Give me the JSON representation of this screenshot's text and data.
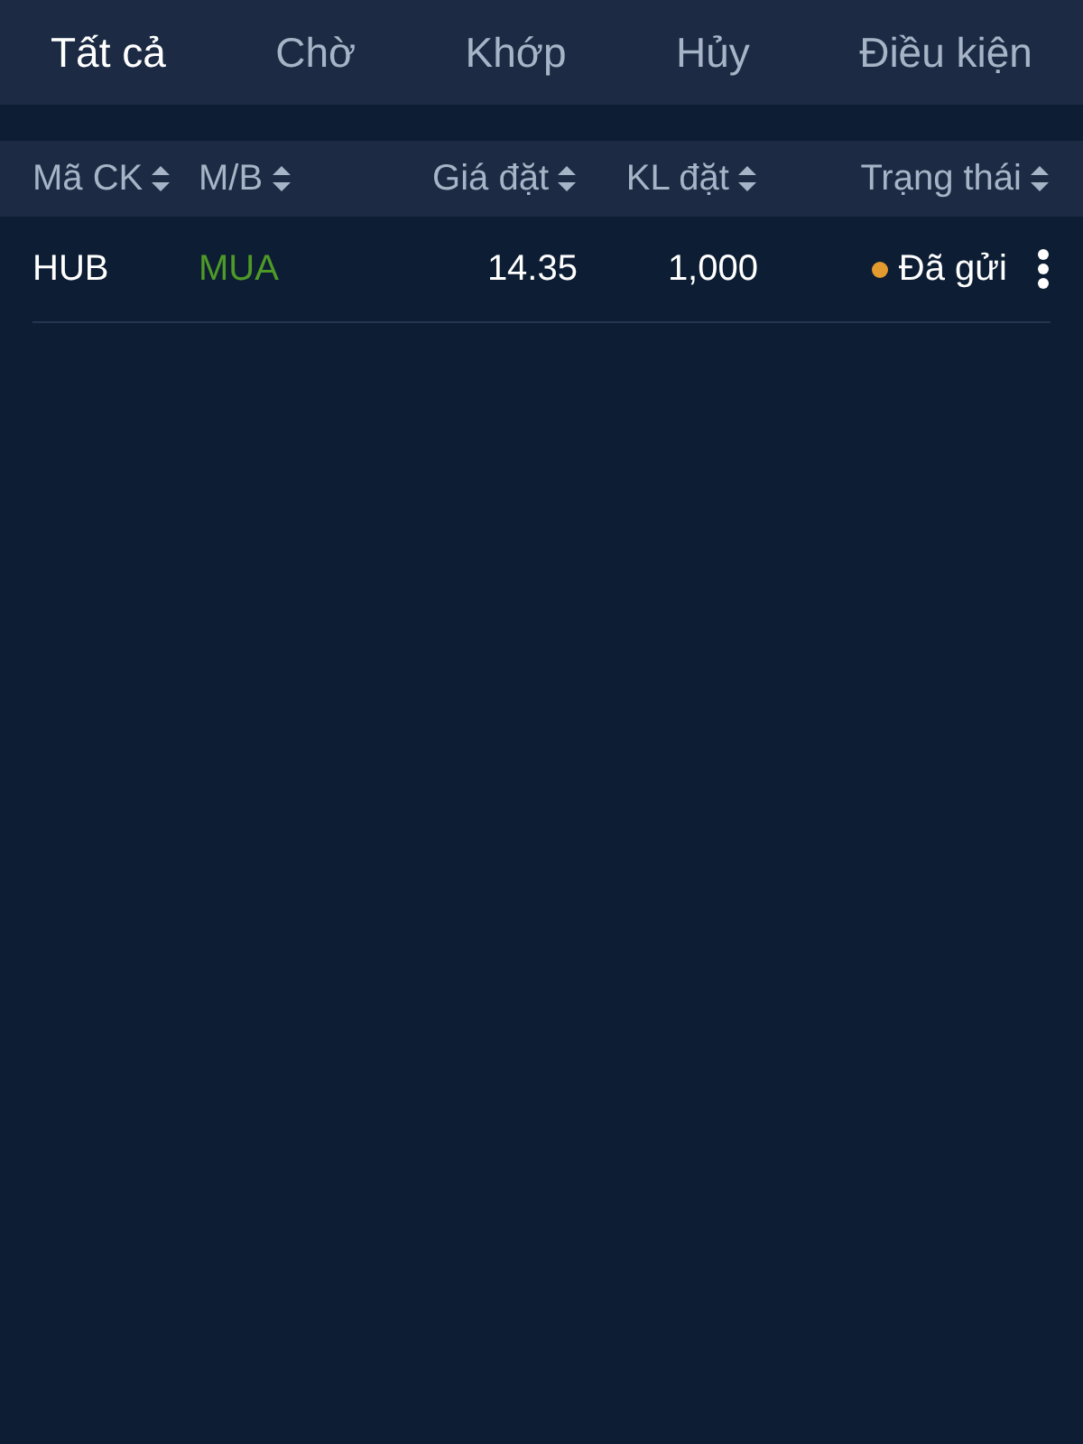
{
  "tabs": [
    {
      "label": "Tất cả",
      "selected": true
    },
    {
      "label": "Chờ",
      "selected": false
    },
    {
      "label": "Khớp",
      "selected": false
    },
    {
      "label": "Hủy",
      "selected": false
    },
    {
      "label": "Điều kiện",
      "selected": false
    }
  ],
  "table": {
    "columns": [
      "Mã CK",
      "M/B",
      "Giá đặt",
      "KL đặt",
      "Trạng thái"
    ],
    "rows": [
      {
        "symbol": "HUB",
        "side": {
          "text": "MUA",
          "kind": "buy"
        },
        "price": "14.35",
        "volume": "1,000",
        "status": {
          "text": "Đã gửi",
          "color": "#e39a2e"
        }
      }
    ]
  }
}
